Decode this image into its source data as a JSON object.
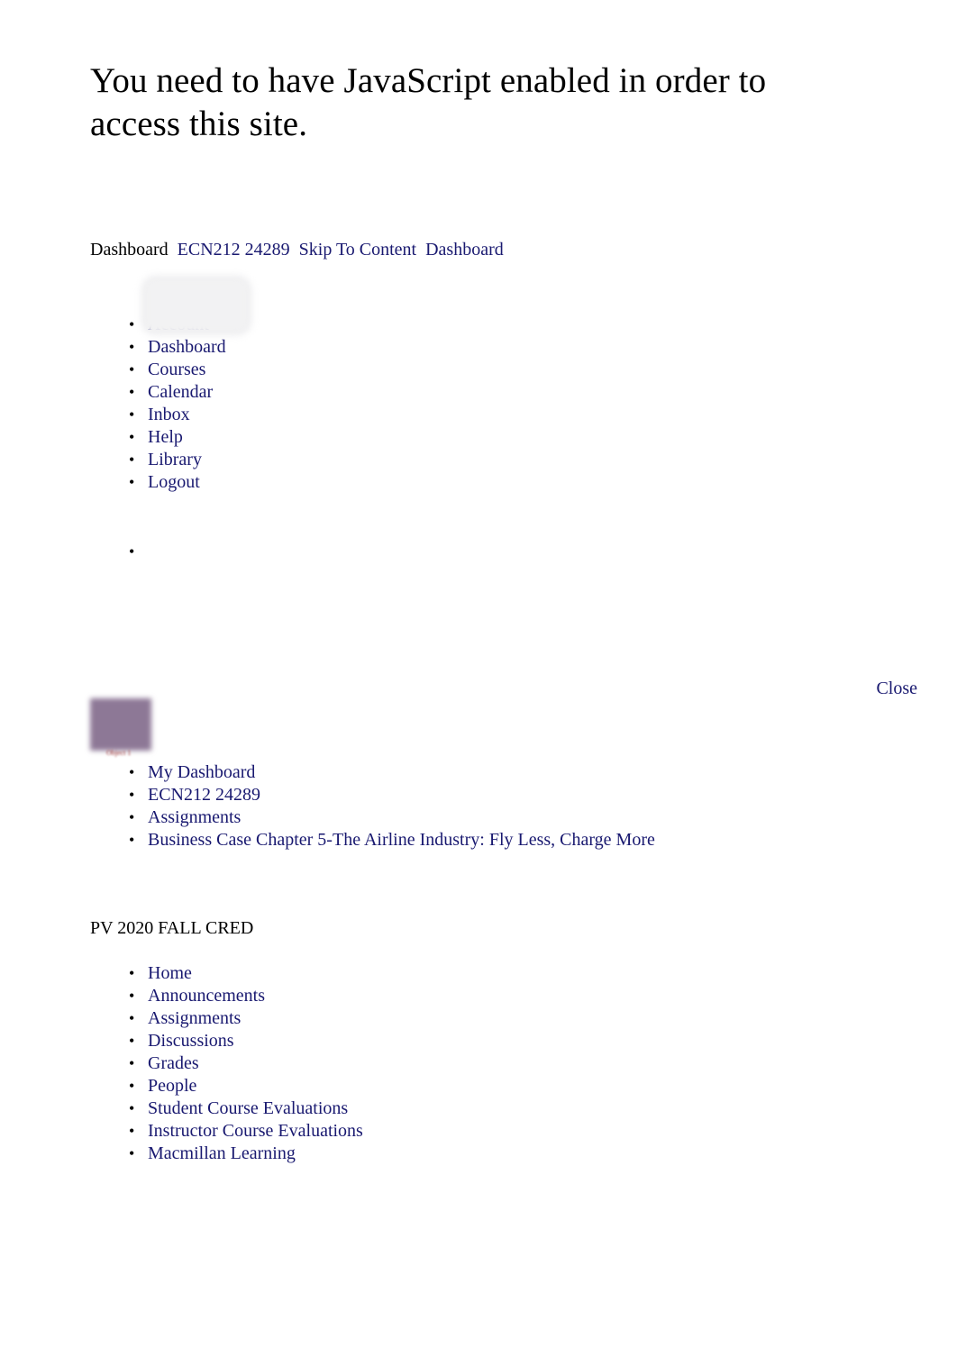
{
  "page": {
    "js_warning": "You need to have JavaScript enabled in order to access this site.",
    "link_color": "#191970",
    "text_color": "#000000",
    "background_color": "#ffffff"
  },
  "top_links": {
    "static_label": "Dashboard",
    "links": [
      "ECN212 24289",
      "Skip To Content",
      "Dashboard"
    ]
  },
  "global_nav": {
    "avatar_alt": "",
    "items": [
      {
        "label": "Account",
        "icon": "avatar-icon"
      },
      {
        "label": "Dashboard",
        "icon": "dashboard-icon"
      },
      {
        "label": "Courses",
        "icon": "courses-icon"
      },
      {
        "label": "Calendar",
        "icon": "calendar-icon"
      },
      {
        "label": "Inbox",
        "icon": "inbox-icon"
      },
      {
        "label": "Help",
        "icon": "help-icon"
      },
      {
        "label": "Library",
        "icon": "library-icon"
      },
      {
        "label": "Logout",
        "icon": "logout-icon"
      }
    ]
  },
  "empty_list": {
    "items": [
      {
        "label": ""
      }
    ]
  },
  "tray": {
    "close_label": "Close"
  },
  "course_thumbnail": {
    "alt_text": "Object 1",
    "color": "#8d7896"
  },
  "breadcrumb": {
    "items": [
      "My Dashboard",
      "ECN212 24289",
      "Assignments",
      "Business Case Chapter 5-The Airline Industry: Fly Less, Charge More"
    ]
  },
  "course": {
    "title": "PV 2020 FALL CRED",
    "nav_items": [
      "Home",
      "Announcements",
      "Assignments",
      "Discussions",
      "Grades",
      "People",
      "Student Course Evaluations",
      "Instructor Course Evaluations",
      "Macmillan Learning"
    ]
  }
}
